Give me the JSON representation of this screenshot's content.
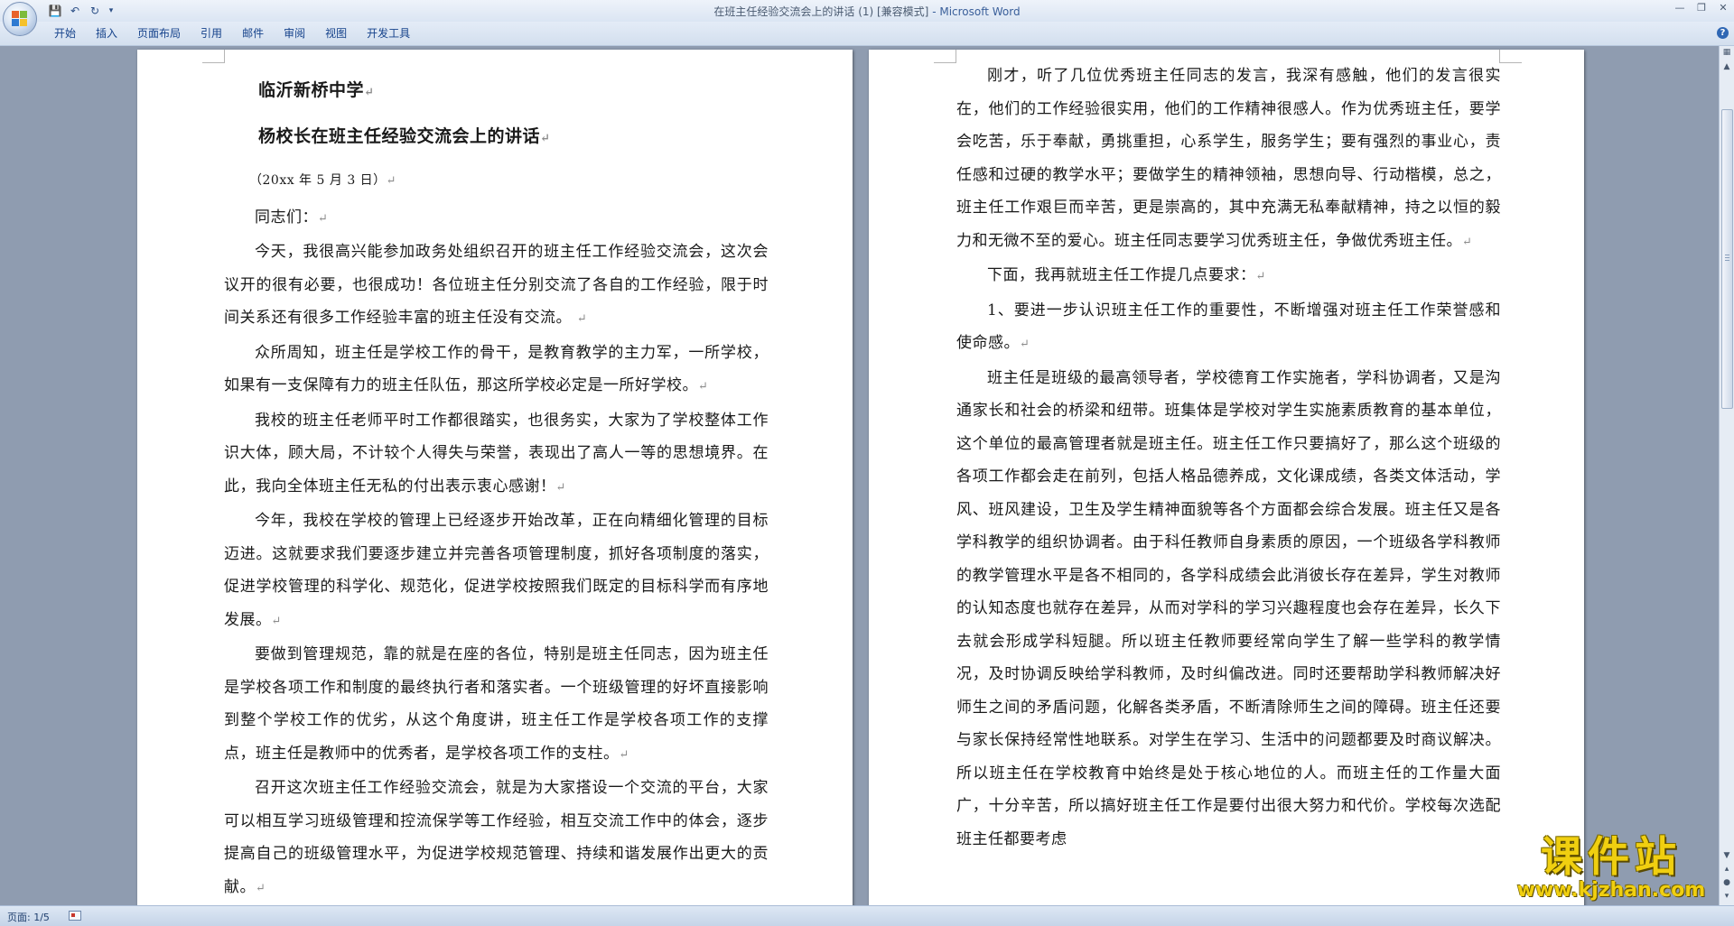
{
  "window": {
    "title": "在班主任经验交流会上的讲话 (1) [兼容模式]",
    "app_suffix": " - Microsoft Word",
    "controls": [
      "—",
      "❐",
      "✕"
    ]
  },
  "quick_access": {
    "save": "💾",
    "undo": "↶",
    "redo": "↻",
    "more": "▾"
  },
  "ribbon": {
    "tabs": [
      "开始",
      "插入",
      "页面布局",
      "引用",
      "邮件",
      "审阅",
      "视图",
      "开发工具"
    ],
    "help": "?"
  },
  "page1": {
    "school": "临沂新桥中学",
    "title": "杨校长在班主任经验交流会上的讲话",
    "date": "（20xx 年 5 月 3 日）",
    "salutation": "同志们：",
    "paragraphs": [
      "今天，我很高兴能参加政务处组织召开的班主任工作经验交流会，这次会议开的很有必要，也很成功！各位班主任分别交流了各自的工作经验，限于时间关系还有很多工作经验丰富的班主任没有交流。",
      "众所周知，班主任是学校工作的骨干，是教育教学的主力军，一所学校，如果有一支保障有力的班主任队伍，那这所学校必定是一所好学校。",
      "我校的班主任老师平时工作都很踏实，也很务实，大家为了学校整体工作识大体，顾大局，不计较个人得失与荣誉，表现出了高人一等的思想境界。在此，我向全体班主任无私的付出表示衷心感谢！",
      "今年，我校在学校的管理上已经逐步开始改革，正在向精细化管理的目标迈进。这就要求我们要逐步建立并完善各项管理制度，抓好各项制度的落实，促进学校管理的科学化、规范化，促进学校按照我们既定的目标科学而有序地发展。",
      "要做到管理规范，靠的就是在座的各位，特别是班主任同志，因为班主任是学校各项工作和制度的最终执行者和落实者。一个班级管理的好坏直接影响到整个学校工作的优劣，从这个角度讲，班主任工作是学校各项工作的支撑点，班主任是教师中的优秀者，是学校各项工作的支柱。",
      "召开这次班主任工作经验交流会，就是为大家搭设一个交流的平台，大家可以相互学习班级管理和控流保学等工作经验，相互交流工作中的体会，逐步提高自己的班级管理水平，为促进学校规范管理、持续和谐发展作出更大的贡献。"
    ]
  },
  "page2": {
    "paragraphs": [
      "刚才，听了几位优秀班主任同志的发言，我深有感触，他们的发言很实在，他们的工作经验很实用，他们的工作精神很感人。作为优秀班主任，要学会吃苦，乐于奉献，勇挑重担，心系学生，服务学生；要有强烈的事业心，责任感和过硬的教学水平；要做学生的精神领袖，思想向导、行动楷模，总之，班主任工作艰巨而辛苦，更是崇高的，其中充满无私奉献精神，持之以恒的毅力和无微不至的爱心。班主任同志要学习优秀班主任，争做优秀班主任。",
      "下面，我再就班主任工作提几点要求：",
      "1、要进一步认识班主任工作的重要性，不断增强对班主任工作荣誉感和使命感。",
      "班主任是班级的最高领导者，学校德育工作实施者，学科协调者，又是沟通家长和社会的桥梁和纽带。班集体是学校对学生实施素质教育的基本单位，这个单位的最高管理者就是班主任。班主任工作只要搞好了，那么这个班级的各项工作都会走在前列，包括人格品德养成，文化课成绩，各类文体活动，学风、班风建设，卫生及学生精神面貌等各个方面都会综合发展。班主任又是各学科教学的组织协调者。由于科任教师自身素质的原因，一个班级各学科教师的教学管理水平是各不相同的，各学科成绩会此消彼长存在差异，学生对教师的认知态度也就存在差异，从而对学科的学习兴趣程度也会存在差异，长久下去就会形成学科短腿。所以班主任教师要经常向学生了解一些学科的教学情况，及时协调反映给学科教师，及时纠偏改进。同时还要帮助学科教师解决好师生之间的矛盾问题，化解各类矛盾，不断清除师生之间的障碍。班主任还要与家长保持经常性地联系。对学生在学习、生活中的问题都要及时商议解决。所以班主任在学校教育中始终是处于核心地位的人。而班主任的工作量大面广，十分辛苦，所以搞好班主任工作是要付出很大努力和代价。学校每次选配班主任都要考虑"
    ]
  },
  "paragraph_mark": "↵",
  "status": {
    "page": "页面: 1/5"
  },
  "watermark": {
    "title": "课件站",
    "url": "www.kjzhan.com"
  }
}
